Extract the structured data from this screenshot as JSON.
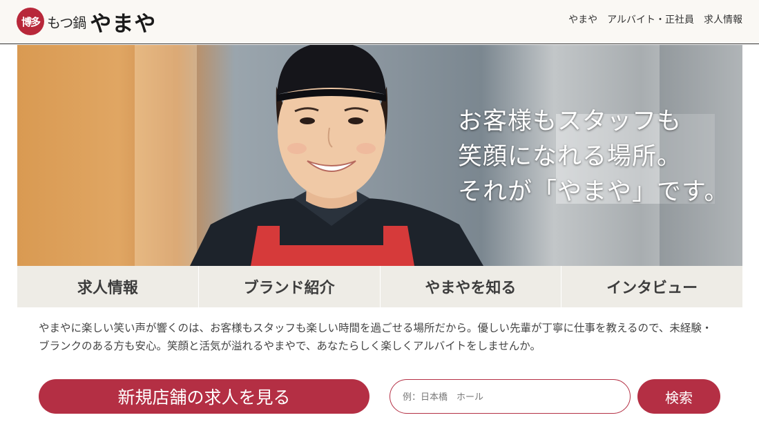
{
  "header": {
    "logo": {
      "seal_text": "博多",
      "sub_text": "もつ鍋",
      "main_text": "やまや"
    },
    "nav": [
      {
        "label": "やまや"
      },
      {
        "label": "アルバイト・正社員"
      },
      {
        "label": "求人情報"
      }
    ]
  },
  "hero": {
    "copy_lines": [
      "お客様もスタッフも",
      "笑顔になれる場所。",
      "それが「やまや」です。"
    ]
  },
  "categories": [
    {
      "label": "求人情報"
    },
    {
      "label": "ブランド紹介"
    },
    {
      "label": "やまやを知る"
    },
    {
      "label": "インタビュー"
    }
  ],
  "intro_text": "やまやに楽しい笑い声が響くのは、お客様もスタッフも楽しい時間を過ごせる場所だから。優しい先輩が丁寧に仕事を教えるので、未経験・ブランクのある方も安心。笑顔と活気が溢れるやまやで、あなたらしく楽しくアルバイトをしませんか。",
  "actions": {
    "new_store_button": "新規店舗の求人を見る",
    "search": {
      "placeholder": "例：日本橋　ホール",
      "value": "",
      "button_label": "検索"
    }
  },
  "colors": {
    "accent": "#b42f44",
    "header_bg": "#faf8f4",
    "category_bg": "#eeece6"
  }
}
